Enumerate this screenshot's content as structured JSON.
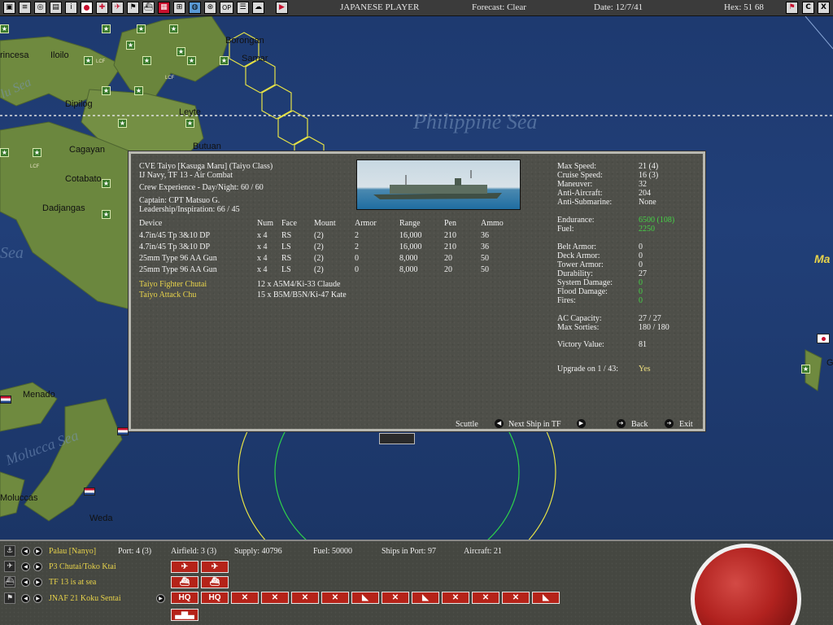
{
  "header": {
    "player": "JAPANESE PLAYER",
    "forecast": "Forecast: Clear",
    "date": "Date: 12/7/41",
    "hex": "Hex: 51 68"
  },
  "toolbar": {
    "icons": [
      "unit-list-icon",
      "report-icon",
      "intel-icon",
      "theater-icon",
      "info-icon",
      "japan-flag-icon",
      "air-icon",
      "aircraft-icon",
      "flag-icon",
      "ship-icon",
      "fleet-icon",
      "land-icon",
      "globe-icon",
      "ops-icon",
      "op-icon",
      "settings-icon",
      "comms-icon",
      "end-turn-icon"
    ],
    "op_label": "OP",
    "right_c_label": "C",
    "right_x_label": "X"
  },
  "map": {
    "places": [
      {
        "name": "rincesa"
      },
      {
        "name": "Iloilo"
      },
      {
        "name": "Borongan"
      },
      {
        "name": "Samar"
      },
      {
        "name": "Dipilog"
      },
      {
        "name": "Leyte"
      },
      {
        "name": "Cagayan"
      },
      {
        "name": "Butuan"
      },
      {
        "name": "Cotabato"
      },
      {
        "name": "Dadjangas"
      },
      {
        "name": "Menado"
      },
      {
        "name": "Moluccas"
      },
      {
        "name": "Weda"
      },
      {
        "name": "Ma"
      },
      {
        "name": "G"
      }
    ],
    "seas": [
      "Philippine Sea",
      "Sea",
      "Molucca Sea",
      "lu Sea"
    ],
    "unit_label": "LCF"
  },
  "ship": {
    "title": "CVE Taiyo [Kasuga Maru] (Taiyo Class)",
    "navy_line": "IJ Navy, TF 13 - Air Combat",
    "crew_experience": "Crew Experience - Day/Night: 60 / 60",
    "captain": "Captain: CPT Matsuo G.",
    "leadership": "Leadership/Inspiration: 66 / 45",
    "weapons_headers": [
      "Device",
      "Num",
      "Face",
      "Mount",
      "Armor",
      "Range",
      "Pen",
      "Ammo"
    ],
    "weapons": [
      [
        "4.7in/45 Tp 3&10 DP",
        "x 4",
        "RS",
        "(2)",
        "2",
        "16,000",
        "210",
        "36"
      ],
      [
        "4.7in/45 Tp 3&10 DP",
        "x 4",
        "LS",
        "(2)",
        "2",
        "16,000",
        "210",
        "36"
      ],
      [
        "25mm Type 96 AA Gun",
        "x 4",
        "RS",
        "(2)",
        "0",
        "8,000",
        "20",
        "50"
      ],
      [
        "25mm Type 96 AA Gun",
        "x 4",
        "LS",
        "(2)",
        "0",
        "8,000",
        "20",
        "50"
      ]
    ],
    "air_groups": [
      {
        "name": "Taiyo Fighter Chutai",
        "aircraft": "12 x A5M4/Ki-33 Claude"
      },
      {
        "name": "Taiyo Attack Chu",
        "aircraft": "15 x B5M/B5N/Ki-47 Kate"
      }
    ],
    "stats": [
      {
        "label": "Max Speed:",
        "value": "21 (4)",
        "color": "white"
      },
      {
        "label": "Cruise Speed:",
        "value": "16 (3)",
        "color": "white"
      },
      {
        "label": "Maneuver:",
        "value": "32",
        "color": "white"
      },
      {
        "label": "Anti-Aircraft:",
        "value": "204",
        "color": "white"
      },
      {
        "label": "Anti-Submarine:",
        "value": "None",
        "color": "white"
      },
      {
        "label": "Endurance:",
        "value": "6500 (108)",
        "color": "green"
      },
      {
        "label": "Fuel:",
        "value": "2250",
        "color": "green"
      },
      {
        "label": "Belt Armor:",
        "value": "0",
        "color": "white"
      },
      {
        "label": "Deck Armor:",
        "value": "0",
        "color": "white"
      },
      {
        "label": "Tower Armor:",
        "value": "0",
        "color": "white"
      },
      {
        "label": "Durability:",
        "value": "27",
        "color": "white"
      },
      {
        "label": "System Damage:",
        "value": "0",
        "color": "green"
      },
      {
        "label": "Flood Damage:",
        "value": "0",
        "color": "green"
      },
      {
        "label": "Fires:",
        "value": "0",
        "color": "green"
      },
      {
        "label": "AC Capacity:",
        "value": "27 / 27",
        "color": "white"
      },
      {
        "label": "Max Sorties:",
        "value": "180 / 180",
        "color": "white"
      },
      {
        "label": "Victory Value:",
        "value": "81",
        "color": "white"
      },
      {
        "label": "Upgrade on 1 / 43:",
        "value": "Yes",
        "color": "yellow"
      }
    ],
    "actions": {
      "scuttle": "Scuttle",
      "next_ship": "Next Ship in TF",
      "back": "Back",
      "exit": "Exit"
    }
  },
  "bottom": {
    "rows": [
      {
        "name": "Palau [Nanyo]",
        "icon": "anchor-icon"
      },
      {
        "name": "P3 Chutai/Toko Ktai",
        "icon": "aircraft-icon"
      },
      {
        "name": "TF 13 is at sea",
        "icon": "ship-icon"
      },
      {
        "name": "JNAF 21 Koku Sentai",
        "icon": "flag-icon"
      }
    ],
    "info": {
      "port": "Port: 4 (3)",
      "airfield": "Airfield: 3 (3)",
      "supply": "Supply: 40796",
      "fuel": "Fuel: 50000",
      "ships_in_port": "Ships in Port: 97",
      "aircraft": "Aircraft: 21"
    },
    "counters": [
      {
        "label": "HQ"
      },
      {
        "label": "HQ"
      },
      {
        "label": "✕"
      },
      {
        "label": "✕"
      },
      {
        "label": "✕"
      },
      {
        "label": "✕"
      },
      {
        "label": "◣"
      },
      {
        "label": "✕"
      },
      {
        "label": "◣"
      },
      {
        "label": "✕"
      },
      {
        "label": "✕"
      },
      {
        "label": "✕"
      },
      {
        "label": "◣"
      }
    ]
  },
  "colors": {
    "yellow_text": "#e8d34a",
    "green_text": "#46d246",
    "counter_red": "#b52319",
    "unit_green": "#3b7a2c"
  }
}
